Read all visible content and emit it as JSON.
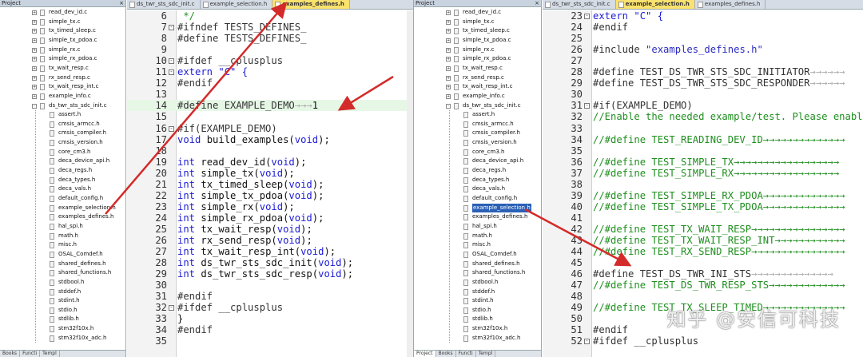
{
  "left": {
    "project": {
      "title": "Project",
      "close": "×",
      "items": [
        {
          "label": "read_dev_id.c",
          "level": 1,
          "pm": "+"
        },
        {
          "label": "simple_tx.c",
          "level": 1,
          "pm": "+"
        },
        {
          "label": "tx_timed_sleep.c",
          "level": 1,
          "pm": "+"
        },
        {
          "label": "simple_tx_pdoa.c",
          "level": 1,
          "pm": "+"
        },
        {
          "label": "simple_rx.c",
          "level": 1,
          "pm": "+"
        },
        {
          "label": "simple_rx_pdoa.c",
          "level": 1,
          "pm": "+"
        },
        {
          "label": "tx_wait_resp.c",
          "level": 1,
          "pm": "+"
        },
        {
          "label": "rx_send_resp.c",
          "level": 1,
          "pm": "+"
        },
        {
          "label": "tx_wait_resp_int.c",
          "level": 1,
          "pm": "+"
        },
        {
          "label": "example_info.c",
          "level": 1,
          "pm": "+"
        },
        {
          "label": "ds_twr_sts_sdc_init.c",
          "level": 1,
          "pm": "-"
        },
        {
          "label": "assert.h",
          "level": 2,
          "pm": ""
        },
        {
          "label": "cmsis_armcc.h",
          "level": 2,
          "pm": ""
        },
        {
          "label": "cmsis_compiler.h",
          "level": 2,
          "pm": ""
        },
        {
          "label": "cmsis_version.h",
          "level": 2,
          "pm": ""
        },
        {
          "label": "core_cm3.h",
          "level": 2,
          "pm": ""
        },
        {
          "label": "deca_device_api.h",
          "level": 2,
          "pm": ""
        },
        {
          "label": "deca_regs.h",
          "level": 2,
          "pm": ""
        },
        {
          "label": "deca_types.h",
          "level": 2,
          "pm": ""
        },
        {
          "label": "deca_vals.h",
          "level": 2,
          "pm": ""
        },
        {
          "label": "default_config.h",
          "level": 2,
          "pm": ""
        },
        {
          "label": "example_selection.h",
          "level": 2,
          "pm": ""
        },
        {
          "label": "examples_defines.h",
          "level": 2,
          "pm": ""
        },
        {
          "label": "hal_spi.h",
          "level": 2,
          "pm": ""
        },
        {
          "label": "math.h",
          "level": 2,
          "pm": ""
        },
        {
          "label": "misc.h",
          "level": 2,
          "pm": ""
        },
        {
          "label": "OSAL_Comdef.h",
          "level": 2,
          "pm": ""
        },
        {
          "label": "shared_defines.h",
          "level": 2,
          "pm": ""
        },
        {
          "label": "shared_functions.h",
          "level": 2,
          "pm": ""
        },
        {
          "label": "stdbool.h",
          "level": 2,
          "pm": ""
        },
        {
          "label": "stddef.h",
          "level": 2,
          "pm": ""
        },
        {
          "label": "stdint.h",
          "level": 2,
          "pm": ""
        },
        {
          "label": "stdio.h",
          "level": 2,
          "pm": ""
        },
        {
          "label": "stdlib.h",
          "level": 2,
          "pm": ""
        },
        {
          "label": "stm32f10x.h",
          "level": 2,
          "pm": ""
        },
        {
          "label": "stm32f10x_adc.h",
          "level": 2,
          "pm": ""
        }
      ],
      "selected": -1,
      "bottom_tabs": [
        "Books",
        "Functi",
        "Templ"
      ]
    },
    "tabs": [
      {
        "label": "ds_twr_sts_sdc_init.c",
        "active": false
      },
      {
        "label": "example_selection.h",
        "active": false
      },
      {
        "label": "examples_defines.h",
        "active": true
      }
    ],
    "code": [
      {
        "n": "6",
        "fold": "",
        "t": [
          [
            "c-cm",
            " */"
          ]
        ]
      },
      {
        "n": "7",
        "fold": "-",
        "t": [
          [
            "c-pp",
            "#ifndef TESTS_DEFINES_"
          ]
        ]
      },
      {
        "n": "8",
        "fold": "",
        "t": [
          [
            "c-pp",
            "#define TESTS_DEFINES_"
          ]
        ]
      },
      {
        "n": "9",
        "fold": "",
        "t": []
      },
      {
        "n": "10",
        "fold": "-",
        "t": [
          [
            "c-pp",
            "#ifdef __cplusplus"
          ]
        ]
      },
      {
        "n": "11",
        "fold": "-",
        "t": [
          [
            "c-kw",
            "extern \"C\" {"
          ]
        ]
      },
      {
        "n": "12",
        "fold": "",
        "t": [
          [
            "c-pp",
            "#endif"
          ]
        ]
      },
      {
        "n": "13",
        "fold": "",
        "t": []
      },
      {
        "n": "14",
        "fold": "",
        "hl": true,
        "t": [
          [
            "c-pp",
            "#define EXAMPLE_DEMO"
          ],
          [
            "c-ar",
            "→→→"
          ],
          [
            "c-df",
            "1"
          ]
        ]
      },
      {
        "n": "15",
        "fold": "",
        "t": []
      },
      {
        "n": "16",
        "fold": "-",
        "t": [
          [
            "c-pp",
            "#if(EXAMPLE_DEMO)"
          ]
        ]
      },
      {
        "n": "17",
        "fold": "",
        "t": [
          [
            "c-kw",
            "void"
          ],
          [
            "c-df",
            " build_examples("
          ],
          [
            "c-kw",
            "void"
          ],
          [
            "c-df",
            ");"
          ]
        ]
      },
      {
        "n": "18",
        "fold": "",
        "t": []
      },
      {
        "n": "19",
        "fold": "",
        "t": [
          [
            "c-kw",
            "int"
          ],
          [
            "c-df",
            " read_dev_id("
          ],
          [
            "c-kw",
            "void"
          ],
          [
            "c-df",
            ");"
          ]
        ]
      },
      {
        "n": "20",
        "fold": "",
        "t": [
          [
            "c-kw",
            "int"
          ],
          [
            "c-df",
            " simple_tx("
          ],
          [
            "c-kw",
            "void"
          ],
          [
            "c-df",
            ");"
          ]
        ]
      },
      {
        "n": "21",
        "fold": "",
        "t": [
          [
            "c-kw",
            "int"
          ],
          [
            "c-df",
            " tx_timed_sleep("
          ],
          [
            "c-kw",
            "void"
          ],
          [
            "c-df",
            ");"
          ]
        ]
      },
      {
        "n": "22",
        "fold": "",
        "t": [
          [
            "c-kw",
            "int"
          ],
          [
            "c-df",
            " simple_tx_pdoa("
          ],
          [
            "c-kw",
            "void"
          ],
          [
            "c-df",
            ");"
          ]
        ]
      },
      {
        "n": "23",
        "fold": "",
        "t": [
          [
            "c-kw",
            "int"
          ],
          [
            "c-df",
            " simple_rx("
          ],
          [
            "c-kw",
            "void"
          ],
          [
            "c-df",
            ");"
          ]
        ]
      },
      {
        "n": "24",
        "fold": "",
        "t": [
          [
            "c-kw",
            "int"
          ],
          [
            "c-df",
            " simple_rx_pdoa("
          ],
          [
            "c-kw",
            "void"
          ],
          [
            "c-df",
            ");"
          ]
        ]
      },
      {
        "n": "25",
        "fold": "",
        "t": [
          [
            "c-kw",
            "int"
          ],
          [
            "c-df",
            " tx_wait_resp("
          ],
          [
            "c-kw",
            "void"
          ],
          [
            "c-df",
            ");"
          ]
        ]
      },
      {
        "n": "26",
        "fold": "",
        "t": [
          [
            "c-kw",
            "int"
          ],
          [
            "c-df",
            " rx_send_resp("
          ],
          [
            "c-kw",
            "void"
          ],
          [
            "c-df",
            ");"
          ]
        ]
      },
      {
        "n": "27",
        "fold": "",
        "t": [
          [
            "c-kw",
            "int"
          ],
          [
            "c-df",
            " tx_wait_resp_int("
          ],
          [
            "c-kw",
            "void"
          ],
          [
            "c-df",
            ");"
          ]
        ]
      },
      {
        "n": "28",
        "fold": "",
        "t": [
          [
            "c-kw",
            "int"
          ],
          [
            "c-df",
            " ds_twr_sts_sdc_init("
          ],
          [
            "c-kw",
            "void"
          ],
          [
            "c-df",
            ");"
          ]
        ]
      },
      {
        "n": "29",
        "fold": "",
        "t": [
          [
            "c-kw",
            "int"
          ],
          [
            "c-df",
            " ds_twr_sts_sdc_resp("
          ],
          [
            "c-kw",
            "void"
          ],
          [
            "c-df",
            ");"
          ]
        ]
      },
      {
        "n": "30",
        "fold": "",
        "t": []
      },
      {
        "n": "31",
        "fold": "",
        "t": [
          [
            "c-pp",
            "#endif"
          ]
        ]
      },
      {
        "n": "32",
        "fold": "-",
        "t": [
          [
            "c-pp",
            "#ifdef __cplusplus"
          ]
        ]
      },
      {
        "n": "33",
        "fold": "",
        "t": [
          [
            "c-df",
            "}"
          ]
        ]
      },
      {
        "n": "34",
        "fold": "",
        "t": [
          [
            "c-pp",
            "#endif"
          ]
        ]
      },
      {
        "n": "35",
        "fold": "",
        "t": []
      }
    ]
  },
  "right": {
    "project": {
      "title": "Project",
      "close": "×",
      "items": [
        {
          "label": "read_dev_id.c",
          "level": 1,
          "pm": "+"
        },
        {
          "label": "simple_tx.c",
          "level": 1,
          "pm": "+"
        },
        {
          "label": "tx_timed_sleep.c",
          "level": 1,
          "pm": "+"
        },
        {
          "label": "simple_tx_pdoa.c",
          "level": 1,
          "pm": "+"
        },
        {
          "label": "simple_rx.c",
          "level": 1,
          "pm": "+"
        },
        {
          "label": "simple_rx_pdoa.c",
          "level": 1,
          "pm": "+"
        },
        {
          "label": "tx_wait_resp.c",
          "level": 1,
          "pm": "+"
        },
        {
          "label": "rx_send_resp.c",
          "level": 1,
          "pm": "+"
        },
        {
          "label": "tx_wait_resp_int.c",
          "level": 1,
          "pm": "+"
        },
        {
          "label": "example_info.c",
          "level": 1,
          "pm": "+"
        },
        {
          "label": "ds_twr_sts_sdc_init.c",
          "level": 1,
          "pm": "-"
        },
        {
          "label": "assert.h",
          "level": 2,
          "pm": ""
        },
        {
          "label": "cmsis_armcc.h",
          "level": 2,
          "pm": ""
        },
        {
          "label": "cmsis_compiler.h",
          "level": 2,
          "pm": ""
        },
        {
          "label": "cmsis_version.h",
          "level": 2,
          "pm": ""
        },
        {
          "label": "core_cm3.h",
          "level": 2,
          "pm": ""
        },
        {
          "label": "deca_device_api.h",
          "level": 2,
          "pm": ""
        },
        {
          "label": "deca_regs.h",
          "level": 2,
          "pm": ""
        },
        {
          "label": "deca_types.h",
          "level": 2,
          "pm": ""
        },
        {
          "label": "deca_vals.h",
          "level": 2,
          "pm": ""
        },
        {
          "label": "default_config.h",
          "level": 2,
          "pm": ""
        },
        {
          "label": "example_selection.h",
          "level": 2,
          "pm": ""
        },
        {
          "label": "examples_defines.h",
          "level": 2,
          "pm": ""
        },
        {
          "label": "hal_spi.h",
          "level": 2,
          "pm": ""
        },
        {
          "label": "math.h",
          "level": 2,
          "pm": ""
        },
        {
          "label": "misc.h",
          "level": 2,
          "pm": ""
        },
        {
          "label": "OSAL_Comdef.h",
          "level": 2,
          "pm": ""
        },
        {
          "label": "shared_defines.h",
          "level": 2,
          "pm": ""
        },
        {
          "label": "shared_functions.h",
          "level": 2,
          "pm": ""
        },
        {
          "label": "stdbool.h",
          "level": 2,
          "pm": ""
        },
        {
          "label": "stddef.h",
          "level": 2,
          "pm": ""
        },
        {
          "label": "stdint.h",
          "level": 2,
          "pm": ""
        },
        {
          "label": "stdio.h",
          "level": 2,
          "pm": ""
        },
        {
          "label": "stdlib.h",
          "level": 2,
          "pm": ""
        },
        {
          "label": "stm32f10x.h",
          "level": 2,
          "pm": ""
        },
        {
          "label": "stm32f10x_adc.h",
          "level": 2,
          "pm": ""
        }
      ],
      "selected": 21,
      "bottom_tabs": [
        "Project",
        "Books",
        "Functi",
        "Templ"
      ]
    },
    "tabs": [
      {
        "label": "ds_twr_sts_sdc_init.c",
        "active": false
      },
      {
        "label": "example_selection.h",
        "active": true
      },
      {
        "label": "examples_defines.h",
        "active": false
      }
    ],
    "code": [
      {
        "n": "23",
        "fold": "-",
        "t": [
          [
            "c-kw",
            "extern \"C\" {"
          ]
        ]
      },
      {
        "n": "24",
        "fold": "",
        "t": [
          [
            "c-pp",
            "#endif"
          ]
        ]
      },
      {
        "n": "25",
        "fold": "",
        "t": []
      },
      {
        "n": "26",
        "fold": "",
        "t": [
          [
            "c-pp",
            "#include "
          ],
          [
            "c-st",
            "\"examples_defines.h\""
          ]
        ]
      },
      {
        "n": "27",
        "fold": "",
        "t": []
      },
      {
        "n": "28",
        "fold": "",
        "t": [
          [
            "c-pp",
            "#define TEST_DS_TWR_STS_SDC_INITIATOR"
          ],
          [
            "c-ar",
            "→→→→→→"
          ]
        ]
      },
      {
        "n": "29",
        "fold": "",
        "t": [
          [
            "c-pp",
            "#define TEST_DS_TWR_STS_SDC_RESPONDER"
          ],
          [
            "c-ar",
            "→→→→→→"
          ]
        ]
      },
      {
        "n": "30",
        "fold": "",
        "t": []
      },
      {
        "n": "31",
        "fold": "-",
        "t": [
          [
            "c-pp",
            "#if(EXAMPLE_DEMO)"
          ]
        ]
      },
      {
        "n": "32",
        "fold": "",
        "t": [
          [
            "c-cm",
            "//Enable the needed example/test. Please enable o"
          ]
        ]
      },
      {
        "n": "33",
        "fold": "",
        "t": []
      },
      {
        "n": "34",
        "fold": "",
        "t": [
          [
            "c-cm",
            "//#define TEST_READING_DEV_ID→→→→→→→→→→→→→→"
          ]
        ]
      },
      {
        "n": "35",
        "fold": "",
        "t": []
      },
      {
        "n": "36",
        "fold": "",
        "t": [
          [
            "c-cm",
            "//#define TEST_SIMPLE_TX→→→→→→→→→→→→→→→→→→"
          ]
        ]
      },
      {
        "n": "37",
        "fold": "",
        "t": [
          [
            "c-cm",
            "//#define TEST_SIMPLE_RX→→→→→→→→→→→→→→→→→→"
          ]
        ]
      },
      {
        "n": "38",
        "fold": "",
        "t": []
      },
      {
        "n": "39",
        "fold": "",
        "t": [
          [
            "c-cm",
            "//#define TEST_SIMPLE_RX_PDOA→→→→→→→→→→→→→→"
          ]
        ]
      },
      {
        "n": "40",
        "fold": "",
        "t": [
          [
            "c-cm",
            "//#define TEST_SIMPLE_TX_PDOA→→→→→→→→→→→→→→"
          ]
        ]
      },
      {
        "n": "41",
        "fold": "",
        "t": []
      },
      {
        "n": "42",
        "fold": "",
        "t": [
          [
            "c-cm",
            "//#define TEST_TX_WAIT_RESP→→→→→→→→→→→→→→→→"
          ]
        ]
      },
      {
        "n": "43",
        "fold": "",
        "t": [
          [
            "c-cm",
            "//#define TEST_TX_WAIT_RESP_INT→→→→→→→→→→→→"
          ]
        ]
      },
      {
        "n": "44",
        "fold": "",
        "t": [
          [
            "c-cm",
            "//#define TEST_RX_SEND_RESP→→→→→→→→→→→→→→→→"
          ]
        ]
      },
      {
        "n": "45",
        "fold": "",
        "t": []
      },
      {
        "n": "46",
        "fold": "",
        "t": [
          [
            "c-pp",
            "#define TEST_DS_TWR_INI_STS"
          ],
          [
            "c-ar",
            "→→→→→→→→→→→→→→"
          ]
        ]
      },
      {
        "n": "47",
        "fold": "",
        "t": [
          [
            "c-cm",
            "//#define TEST_DS_TWR_RESP_STS→→→→→→→→→→→→→"
          ]
        ]
      },
      {
        "n": "48",
        "fold": "",
        "t": []
      },
      {
        "n": "49",
        "fold": "",
        "t": [
          [
            "c-cm",
            "//#define TEST_TX_SLEEP_TIMED→→→→→→→→→→→→→→"
          ]
        ]
      },
      {
        "n": "50",
        "fold": "",
        "t": []
      },
      {
        "n": "51",
        "fold": "",
        "t": [
          [
            "c-pp",
            "#endif"
          ]
        ]
      },
      {
        "n": "52",
        "fold": "-",
        "t": [
          [
            "c-pp",
            "#ifdef __cplusplus"
          ]
        ]
      }
    ]
  },
  "watermark": "知乎 @安信可科技",
  "colors": {
    "annotation_arrow": "#d42a2a",
    "active_tab": "#f9e26e",
    "selection": "#2a60b6",
    "keyword": "#1b1bd6",
    "comment": "#1f8f1f"
  }
}
